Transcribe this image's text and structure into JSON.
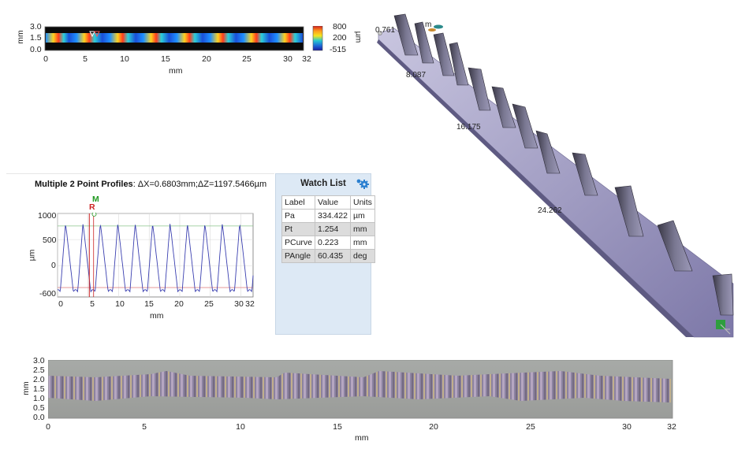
{
  "heatmap": {
    "y_axis_label": "mm",
    "y_ticks": [
      "3.0",
      "1.5",
      "0.0"
    ],
    "x_ticks": [
      "0",
      "5",
      "10",
      "15",
      "20",
      "25",
      "30",
      "32"
    ],
    "x_axis_label": "mm",
    "colorbar_ticks": [
      "800",
      "200",
      "-515"
    ],
    "colorbar_unit": "µm"
  },
  "view3d": {
    "labels": [
      "0.761",
      "8.087",
      "16.175",
      "24.262"
    ],
    "partial_label": "m"
  },
  "profile": {
    "title_bold": "Multiple 2 Point Profiles",
    "title_rest": ": ΔX=0.6803mm;ΔZ=1197.5466µm",
    "y_axis_label": "µm",
    "y_ticks": [
      "1000",
      "500",
      "0",
      "-600"
    ],
    "x_ticks": [
      "0",
      "5",
      "10",
      "15",
      "20",
      "25",
      "30",
      "32"
    ],
    "x_axis_label": "mm",
    "marker_m": "M",
    "marker_r": "R",
    "colors": {
      "line": "#3a3fb0",
      "cursor_r": "#cc2222",
      "cursor_m": "#229922"
    }
  },
  "watch_list": {
    "title": "Watch List",
    "settings_icon": "gear-icon",
    "columns": [
      "Label",
      "Value",
      "Units"
    ],
    "rows": [
      [
        "Pa",
        "334.422",
        "µm"
      ],
      [
        "Pt",
        "1.254",
        "mm"
      ],
      [
        "PCurve",
        "0.223",
        "mm"
      ],
      [
        "PAngle",
        "60.435",
        "deg"
      ]
    ]
  },
  "optical": {
    "y_axis_label": "mm",
    "y_ticks": [
      "3.0",
      "2.5",
      "2.0",
      "1.5",
      "1.0",
      "0.5",
      "0.0"
    ],
    "x_ticks": [
      "0",
      "5",
      "10",
      "15",
      "20",
      "25",
      "30",
      "32"
    ],
    "x_axis_label": "mm"
  }
}
